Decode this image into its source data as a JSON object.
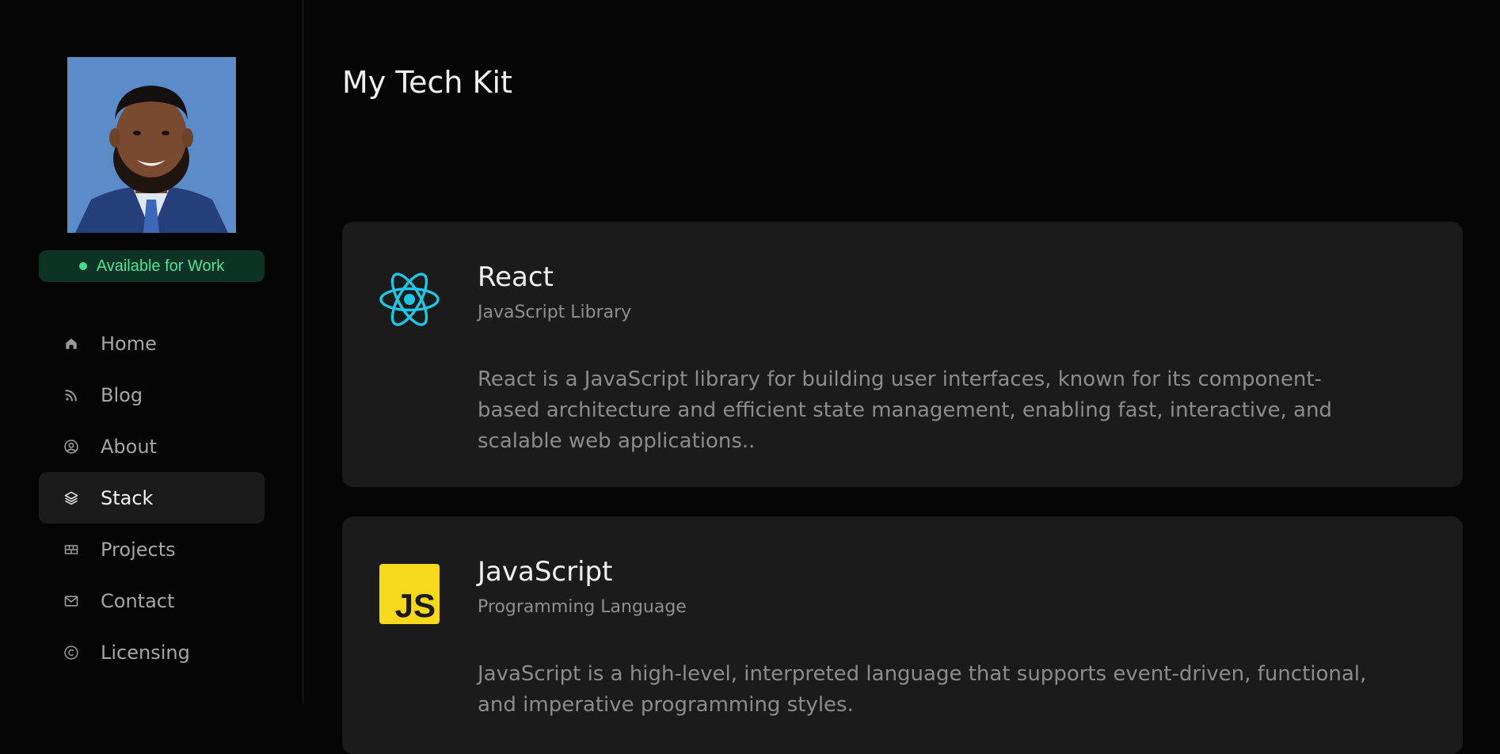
{
  "sidebar": {
    "profile_photo_icon": "person-portrait",
    "availability": {
      "label": "Available for Work",
      "status_color": "#3ee08a"
    },
    "nav": [
      {
        "label": "Home",
        "icon": "home-icon",
        "active": false
      },
      {
        "label": "Blog",
        "icon": "rss-icon",
        "active": false
      },
      {
        "label": "About",
        "icon": "user-circle-icon",
        "active": false
      },
      {
        "label": "Stack",
        "icon": "layers-icon",
        "active": true
      },
      {
        "label": "Projects",
        "icon": "grid-icon",
        "active": false
      },
      {
        "label": "Contact",
        "icon": "mail-icon",
        "active": false
      },
      {
        "label": "Licensing",
        "icon": "copyright-icon",
        "active": false
      }
    ]
  },
  "main": {
    "title": "My Tech Kit",
    "stack": [
      {
        "name": "React",
        "type": "JavaScript Library",
        "description": "React is a JavaScript library for building user interfaces, known for its component-based architecture and efficient state management, enabling fast, interactive, and scalable web applications..",
        "logo": "react-logo",
        "color": "#1fc7e6"
      },
      {
        "name": "JavaScript",
        "type": "Programming Language",
        "description": "JavaScript is a high-level, interpreted language that supports event-driven, functional, and imperative programming styles.",
        "logo": "javascript-logo",
        "logo_text": "JS",
        "color": "#f6d81c"
      }
    ]
  },
  "colors": {
    "background": "#050505",
    "card": "#1b1b1b",
    "available_badge_bg": "#0c3324",
    "available_text": "#4fe39a"
  }
}
